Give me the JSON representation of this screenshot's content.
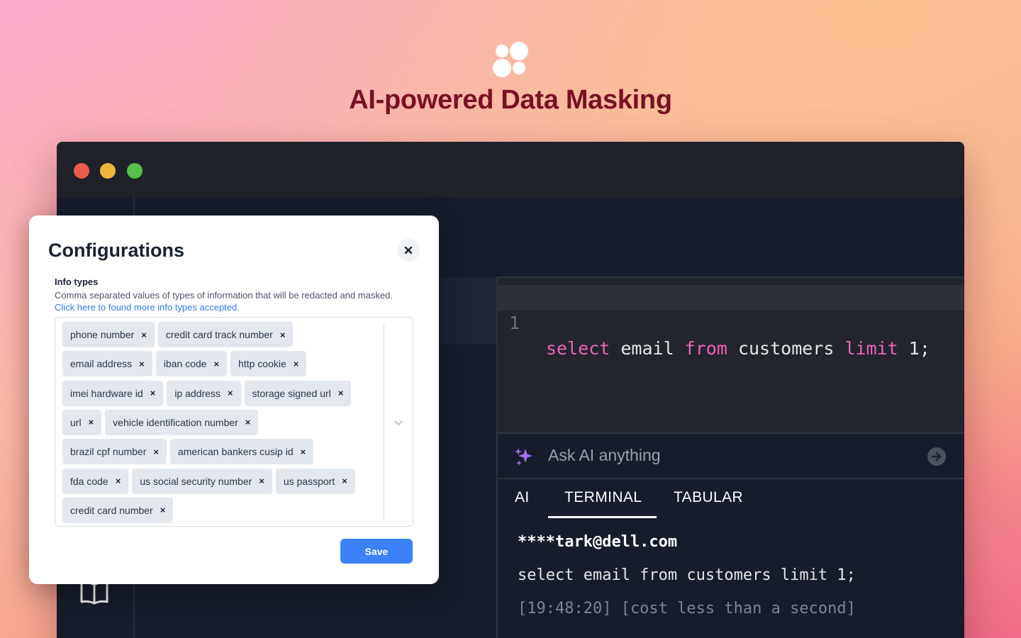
{
  "hero": {
    "title": "AI-powered Data Masking",
    "logo_icon": "four-dots-logo"
  },
  "window": {
    "controls": [
      "close-dot",
      "minimize-dot",
      "maximize-dot"
    ],
    "sidebar_icon": "book-icon"
  },
  "editor": {
    "line_number": "1",
    "code_parts": {
      "kw_select": "select",
      "t_email": " email ",
      "kw_from": "from",
      "t_customers": " customers ",
      "kw_limit": "limit",
      "t_end": " 1;"
    }
  },
  "ai_bar": {
    "placeholder": "Ask AI anything"
  },
  "tabs": [
    {
      "label": "AI"
    },
    {
      "label": "TERMINAL",
      "active": true
    },
    {
      "label": "TABULAR"
    }
  ],
  "terminal": {
    "lines": [
      "****tark@dell.com",
      "select email from customers limit 1;",
      "[19:48:20] [cost less than a second]"
    ]
  },
  "modal": {
    "title": "Configurations",
    "field_label": "Info types",
    "help_text": "Comma separated values of types of information that will be redacted and masked.",
    "help_link": "Click here to found more info types accepted.",
    "tag_rows": [
      [
        "phone number",
        "credit card track number"
      ],
      [
        "email address",
        "iban code",
        "http cookie"
      ],
      [
        "imei hardware id",
        "ip address",
        "storage signed url"
      ],
      [
        "url",
        "vehicle identification number"
      ],
      [
        "brazil cpf number",
        "american bankers cusip id"
      ],
      [
        "fda code",
        "us social security number",
        "us passport"
      ],
      [
        "credit card number"
      ]
    ],
    "tag_remove_glyph": "×",
    "save_label": "Save"
  },
  "colors": {
    "brand_title": "#7a0f24",
    "keyword": "#f062b8",
    "primary_button": "#3b82f6",
    "link": "#2f7cf6",
    "sparkle": "#a56bf5"
  }
}
